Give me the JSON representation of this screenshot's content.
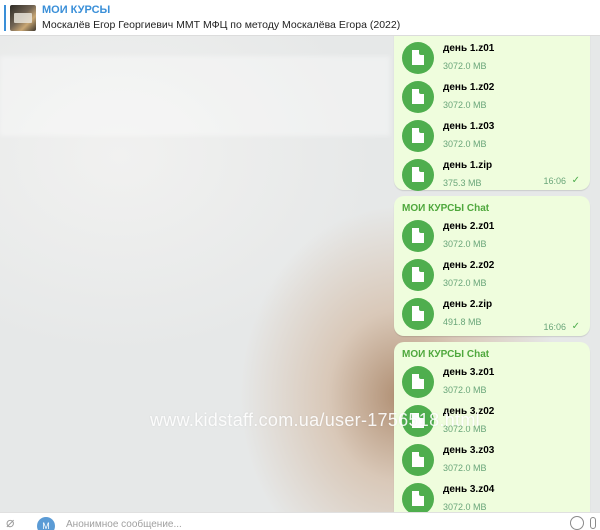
{
  "pinned": {
    "channel": "МОИ КУРСЫ",
    "text": "Москалёв Егор Георгиевич ММТ МФЦ по методу Москалёва Егора (2022)"
  },
  "watermark": "www.kidstaff.com.ua/user-1756518.html",
  "messages": [
    {
      "sender": "",
      "files": [
        {
          "name": "день  1.z01",
          "size": "3072.0 MB"
        },
        {
          "name": "день  1.z02",
          "size": "3072.0 MB"
        },
        {
          "name": "день  1.z03",
          "size": "3072.0 MB"
        },
        {
          "name": "день  1.zip",
          "size": "375.3 MB"
        }
      ],
      "time": "16:06"
    },
    {
      "sender": "МОИ КУРСЫ Chat",
      "files": [
        {
          "name": "день  2.z01",
          "size": "3072.0 MB"
        },
        {
          "name": "день  2.z02",
          "size": "3072.0 MB"
        },
        {
          "name": "день  2.zip",
          "size": "491.8 MB"
        }
      ],
      "time": "16:06"
    },
    {
      "sender": "МОИ КУРСЫ Chat",
      "files": [
        {
          "name": "день  3.z01",
          "size": "3072.0 MB"
        },
        {
          "name": "день  3.z02",
          "size": "3072.0 MB"
        },
        {
          "name": "день  3.z03",
          "size": "3072.0 MB"
        },
        {
          "name": "день  3.z04",
          "size": "3072.0 MB"
        }
      ],
      "time": ""
    }
  ],
  "input": {
    "avatar_letter": "М",
    "placeholder": "Анонимное сообщение..."
  },
  "icons": {
    "attach": "paperclip-icon",
    "file": "file-icon",
    "read": "checkmark-icon",
    "emoji": "emoji-icon",
    "voice": "microphone-icon"
  },
  "colors": {
    "accent": "#3a8fd8",
    "bubble": "#effddd",
    "file_icon": "#4fae4e",
    "sender": "#4fa83d"
  }
}
